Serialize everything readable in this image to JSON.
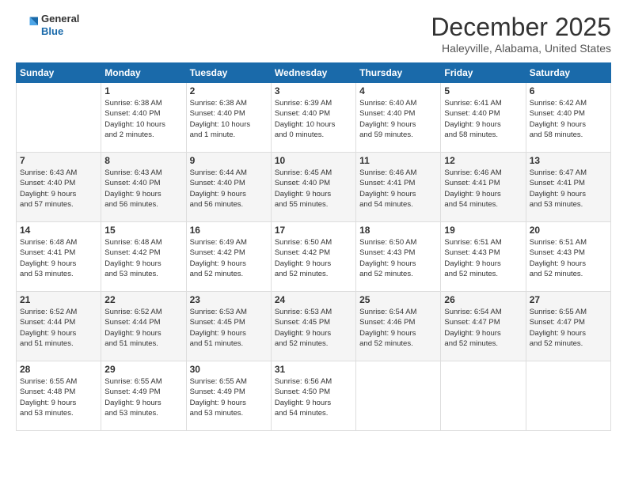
{
  "logo": {
    "line1": "General",
    "line2": "Blue"
  },
  "title": "December 2025",
  "location": "Haleyville, Alabama, United States",
  "weekdays": [
    "Sunday",
    "Monday",
    "Tuesday",
    "Wednesday",
    "Thursday",
    "Friday",
    "Saturday"
  ],
  "weeks": [
    [
      {
        "day": "",
        "info": ""
      },
      {
        "day": "1",
        "info": "Sunrise: 6:38 AM\nSunset: 4:40 PM\nDaylight: 10 hours\nand 2 minutes."
      },
      {
        "day": "2",
        "info": "Sunrise: 6:38 AM\nSunset: 4:40 PM\nDaylight: 10 hours\nand 1 minute."
      },
      {
        "day": "3",
        "info": "Sunrise: 6:39 AM\nSunset: 4:40 PM\nDaylight: 10 hours\nand 0 minutes."
      },
      {
        "day": "4",
        "info": "Sunrise: 6:40 AM\nSunset: 4:40 PM\nDaylight: 9 hours\nand 59 minutes."
      },
      {
        "day": "5",
        "info": "Sunrise: 6:41 AM\nSunset: 4:40 PM\nDaylight: 9 hours\nand 58 minutes."
      },
      {
        "day": "6",
        "info": "Sunrise: 6:42 AM\nSunset: 4:40 PM\nDaylight: 9 hours\nand 58 minutes."
      }
    ],
    [
      {
        "day": "7",
        "info": "Sunrise: 6:43 AM\nSunset: 4:40 PM\nDaylight: 9 hours\nand 57 minutes."
      },
      {
        "day": "8",
        "info": "Sunrise: 6:43 AM\nSunset: 4:40 PM\nDaylight: 9 hours\nand 56 minutes."
      },
      {
        "day": "9",
        "info": "Sunrise: 6:44 AM\nSunset: 4:40 PM\nDaylight: 9 hours\nand 56 minutes."
      },
      {
        "day": "10",
        "info": "Sunrise: 6:45 AM\nSunset: 4:40 PM\nDaylight: 9 hours\nand 55 minutes."
      },
      {
        "day": "11",
        "info": "Sunrise: 6:46 AM\nSunset: 4:41 PM\nDaylight: 9 hours\nand 54 minutes."
      },
      {
        "day": "12",
        "info": "Sunrise: 6:46 AM\nSunset: 4:41 PM\nDaylight: 9 hours\nand 54 minutes."
      },
      {
        "day": "13",
        "info": "Sunrise: 6:47 AM\nSunset: 4:41 PM\nDaylight: 9 hours\nand 53 minutes."
      }
    ],
    [
      {
        "day": "14",
        "info": "Sunrise: 6:48 AM\nSunset: 4:41 PM\nDaylight: 9 hours\nand 53 minutes."
      },
      {
        "day": "15",
        "info": "Sunrise: 6:48 AM\nSunset: 4:42 PM\nDaylight: 9 hours\nand 53 minutes."
      },
      {
        "day": "16",
        "info": "Sunrise: 6:49 AM\nSunset: 4:42 PM\nDaylight: 9 hours\nand 52 minutes."
      },
      {
        "day": "17",
        "info": "Sunrise: 6:50 AM\nSunset: 4:42 PM\nDaylight: 9 hours\nand 52 minutes."
      },
      {
        "day": "18",
        "info": "Sunrise: 6:50 AM\nSunset: 4:43 PM\nDaylight: 9 hours\nand 52 minutes."
      },
      {
        "day": "19",
        "info": "Sunrise: 6:51 AM\nSunset: 4:43 PM\nDaylight: 9 hours\nand 52 minutes."
      },
      {
        "day": "20",
        "info": "Sunrise: 6:51 AM\nSunset: 4:43 PM\nDaylight: 9 hours\nand 52 minutes."
      }
    ],
    [
      {
        "day": "21",
        "info": "Sunrise: 6:52 AM\nSunset: 4:44 PM\nDaylight: 9 hours\nand 51 minutes."
      },
      {
        "day": "22",
        "info": "Sunrise: 6:52 AM\nSunset: 4:44 PM\nDaylight: 9 hours\nand 51 minutes."
      },
      {
        "day": "23",
        "info": "Sunrise: 6:53 AM\nSunset: 4:45 PM\nDaylight: 9 hours\nand 51 minutes."
      },
      {
        "day": "24",
        "info": "Sunrise: 6:53 AM\nSunset: 4:45 PM\nDaylight: 9 hours\nand 52 minutes."
      },
      {
        "day": "25",
        "info": "Sunrise: 6:54 AM\nSunset: 4:46 PM\nDaylight: 9 hours\nand 52 minutes."
      },
      {
        "day": "26",
        "info": "Sunrise: 6:54 AM\nSunset: 4:47 PM\nDaylight: 9 hours\nand 52 minutes."
      },
      {
        "day": "27",
        "info": "Sunrise: 6:55 AM\nSunset: 4:47 PM\nDaylight: 9 hours\nand 52 minutes."
      }
    ],
    [
      {
        "day": "28",
        "info": "Sunrise: 6:55 AM\nSunset: 4:48 PM\nDaylight: 9 hours\nand 53 minutes."
      },
      {
        "day": "29",
        "info": "Sunrise: 6:55 AM\nSunset: 4:49 PM\nDaylight: 9 hours\nand 53 minutes."
      },
      {
        "day": "30",
        "info": "Sunrise: 6:55 AM\nSunset: 4:49 PM\nDaylight: 9 hours\nand 53 minutes."
      },
      {
        "day": "31",
        "info": "Sunrise: 6:56 AM\nSunset: 4:50 PM\nDaylight: 9 hours\nand 54 minutes."
      },
      {
        "day": "",
        "info": ""
      },
      {
        "day": "",
        "info": ""
      },
      {
        "day": "",
        "info": ""
      }
    ]
  ]
}
